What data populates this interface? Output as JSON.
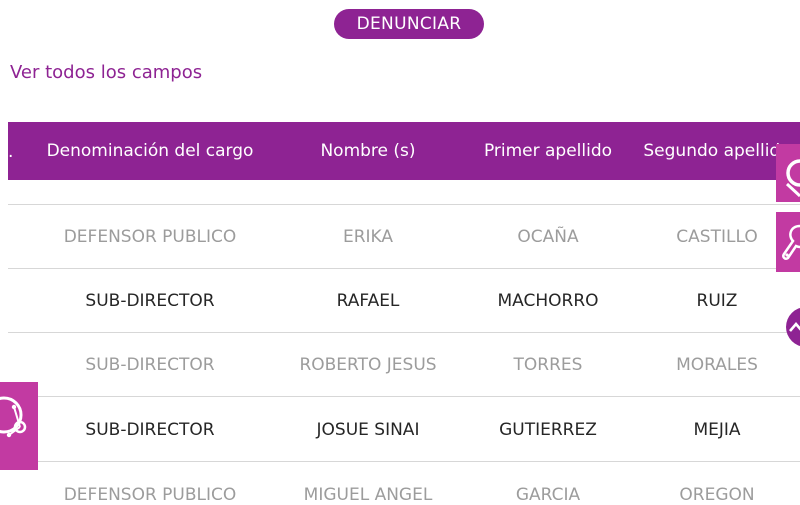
{
  "actions": {
    "denunciar_label": "DENUNCIAR",
    "ver_todos_label": "Ver todos los campos"
  },
  "table": {
    "header_cut_label": ".",
    "columns": [
      "Denominación del cargo",
      "Nombre (s)",
      "Primer apellido",
      "Segundo apellido"
    ],
    "rows": [
      [
        "DEFENSOR PUBLICO",
        "ERIKA",
        "OCAÑA",
        "CASTILLO"
      ],
      [
        "SUB-DIRECTOR",
        "RAFAEL",
        "MACHORRO",
        "RUIZ"
      ],
      [
        "SUB-DIRECTOR",
        "ROBERTO JESUS",
        "TORRES",
        "MORALES"
      ],
      [
        "SUB-DIRECTOR",
        "JOSUE SINAI",
        "GUTIERREZ",
        "MEJIA"
      ],
      [
        "DEFENSOR PUBLICO",
        "MIGUEL ANGEL",
        "GARCIA",
        "OREGON"
      ]
    ]
  },
  "icons": {
    "side_tab_top": "search-icon",
    "side_tab_middle": "wrench-icon",
    "scroll_button": "chevron-up-icon",
    "left_bubble": "network-icon"
  },
  "colors": {
    "brand_purple": "#8e2393",
    "accent_magenta": "#c23aa2"
  }
}
